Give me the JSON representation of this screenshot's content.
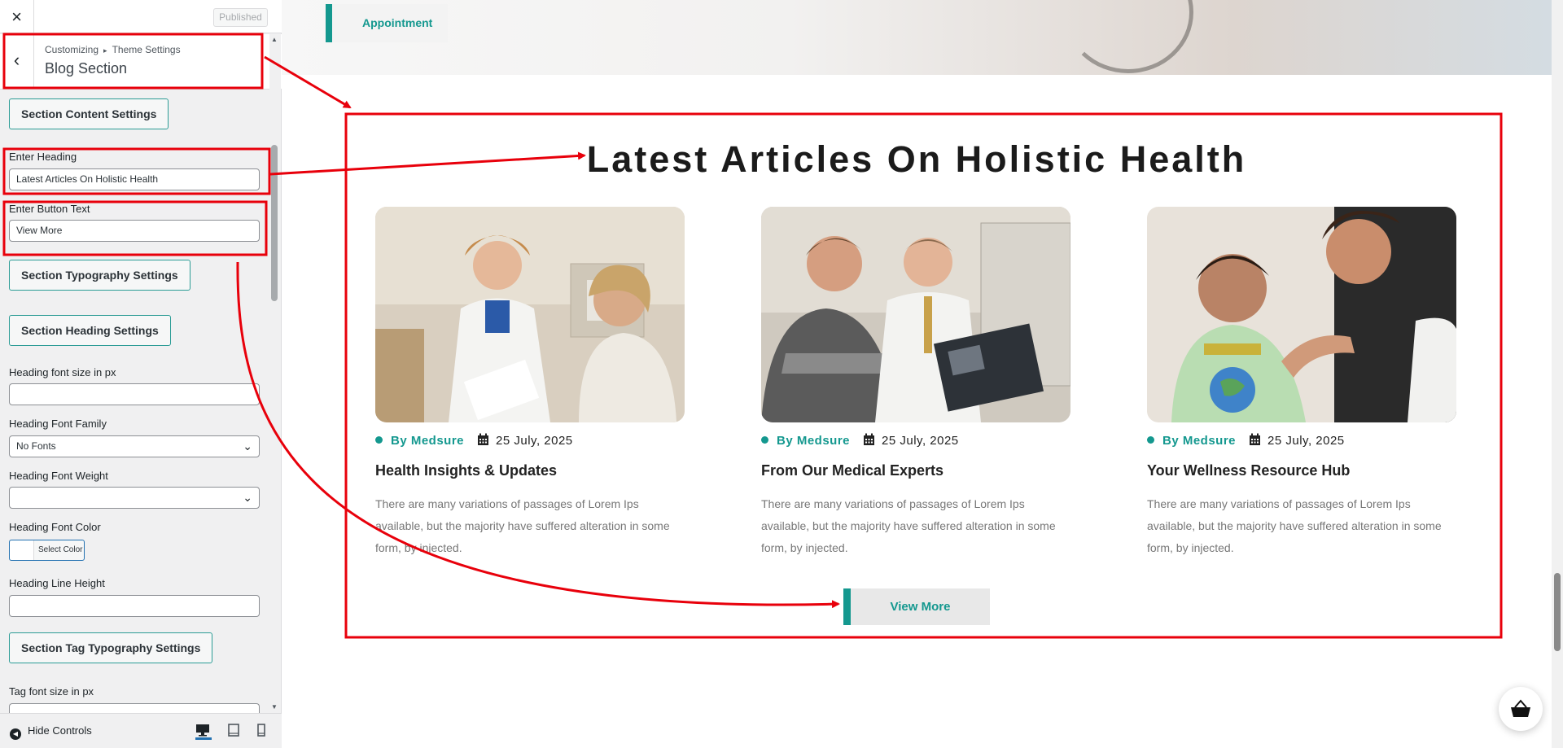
{
  "customizer": {
    "close_icon": "close-icon",
    "published_label": "Published",
    "breadcrumb": [
      "Customizing",
      "Theme Settings"
    ],
    "breadcrumb_sep": "▸",
    "section_title": "Blog Section",
    "btn_content_settings": "Section Content Settings",
    "heading_label": "Enter Heading",
    "heading_value": "Latest Articles On Holistic Health",
    "button_text_label": "Enter Button Text",
    "button_text_value": "View More",
    "btn_typography_settings": "Section Typography Settings",
    "btn_heading_settings": "Section Heading Settings",
    "heading_font_size_label": "Heading font size in px",
    "heading_font_size_value": "",
    "heading_font_family_label": "Heading Font Family",
    "heading_font_family_value": "No Fonts",
    "heading_font_weight_label": "Heading Font Weight",
    "heading_font_weight_value": "",
    "heading_font_color_label": "Heading Font Color",
    "select_color_label": "Select Color",
    "heading_line_height_label": "Heading Line Height",
    "heading_line_height_value": "",
    "btn_tag_typography_settings": "Section Tag Typography Settings",
    "tag_font_size_label": "Tag font size in px",
    "tag_font_size_value": "",
    "hide_controls_label": "Hide Controls"
  },
  "preview": {
    "appointment_label": "Appointment",
    "blog_heading": "Latest Articles On Holistic Health",
    "view_more_label": "View More",
    "cards": [
      {
        "author": "By Medsure",
        "date": "25 July, 2025",
        "title": "Health Insights & Updates",
        "excerpt": "There are many variations of passages of Lorem Ips available, but the majority have suffered alteration in some form, by injected."
      },
      {
        "author": "By Medsure",
        "date": "25 July, 2025",
        "title": "From Our Medical Experts",
        "excerpt": "There are many variations of passages of Lorem Ips available, but the majority have suffered alteration in some form, by injected."
      },
      {
        "author": "By Medsure",
        "date": "25 July, 2025",
        "title": "Your Wellness Resource Hub",
        "excerpt": "There are many variations of passages of Lorem Ips available, but the majority have suffered alteration in some form, by injected."
      }
    ]
  },
  "colors": {
    "accent": "#14988f",
    "annotation": "#e8000b",
    "customizer_button_border": "#2b9c95"
  },
  "icons": {
    "calendar": "calendar-icon",
    "cart": "basket-icon",
    "back": "chevron-left-icon"
  }
}
